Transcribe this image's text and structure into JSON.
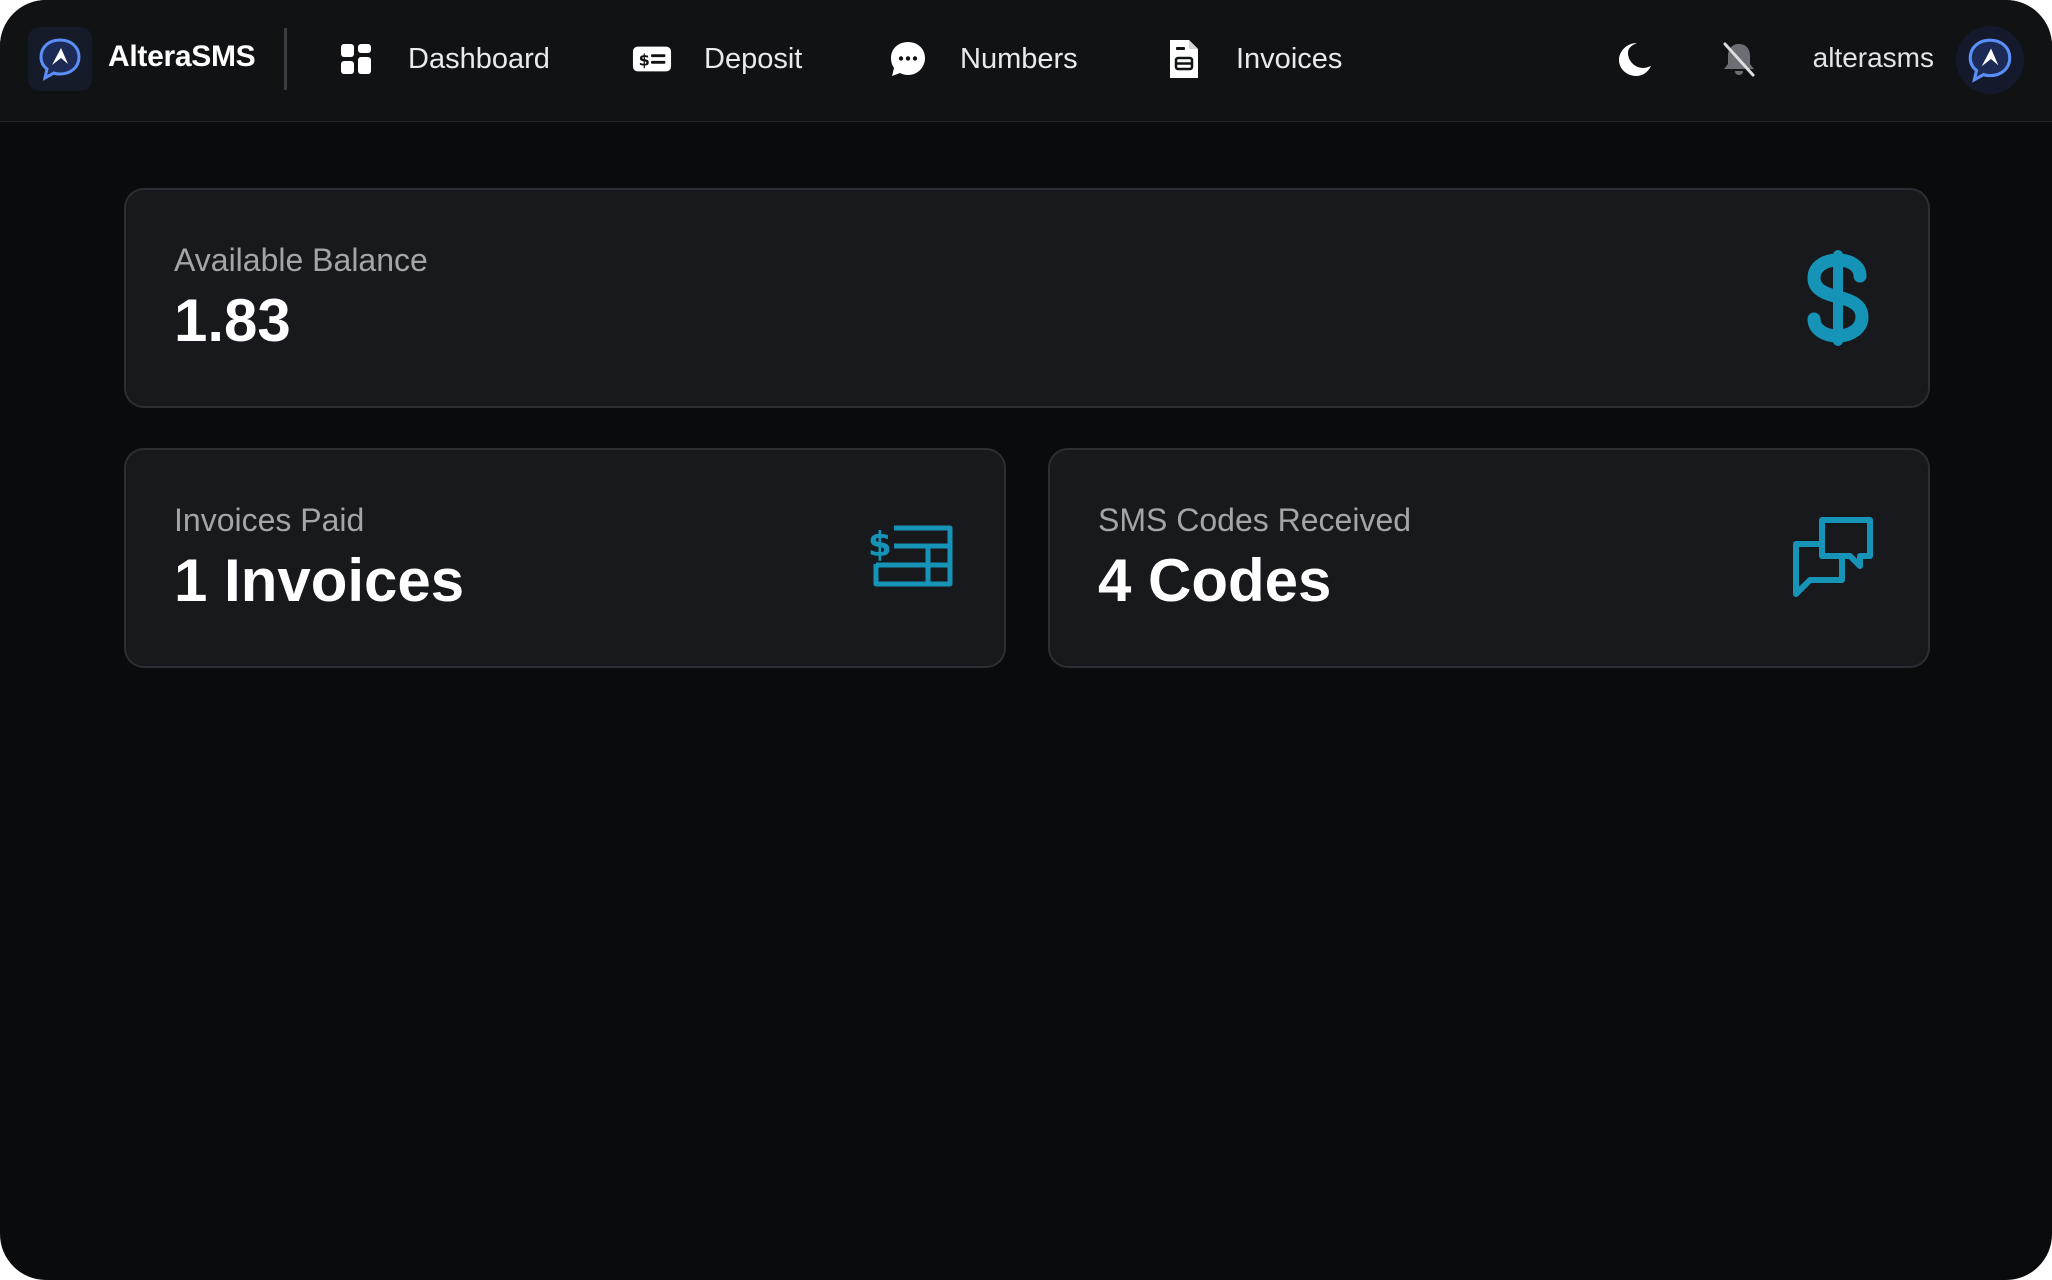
{
  "brand": {
    "name": "AlteraSMS",
    "logo_icon": "altera-logo-icon"
  },
  "nav": {
    "items": [
      {
        "label": "Dashboard",
        "icon": "dashboard-grid-icon"
      },
      {
        "label": "Deposit",
        "icon": "dollar-card-icon"
      },
      {
        "label": "Numbers",
        "icon": "chat-bubble-icon"
      },
      {
        "label": "Invoices",
        "icon": "document-icon"
      }
    ]
  },
  "header_actions": {
    "theme_icon": "moon-icon",
    "notifications_icon": "bell-off-icon",
    "username": "alterasms",
    "avatar_icon": "altera-logo-icon"
  },
  "cards": {
    "balance": {
      "label": "Available Balance",
      "value": "1.83",
      "icon": "dollar-sign-icon"
    },
    "invoices": {
      "label": "Invoices Paid",
      "value": "1 Invoices",
      "icon": "invoice-table-icon"
    },
    "sms": {
      "label": "SMS Codes Received",
      "value": "4 Codes",
      "icon": "chat-bubbles-icon"
    }
  },
  "colors": {
    "background": "#0a0b0d",
    "navbar": "#111214",
    "card": "#18191c",
    "accent": "#1694b8",
    "logo_blue": "#4b8cf5"
  }
}
